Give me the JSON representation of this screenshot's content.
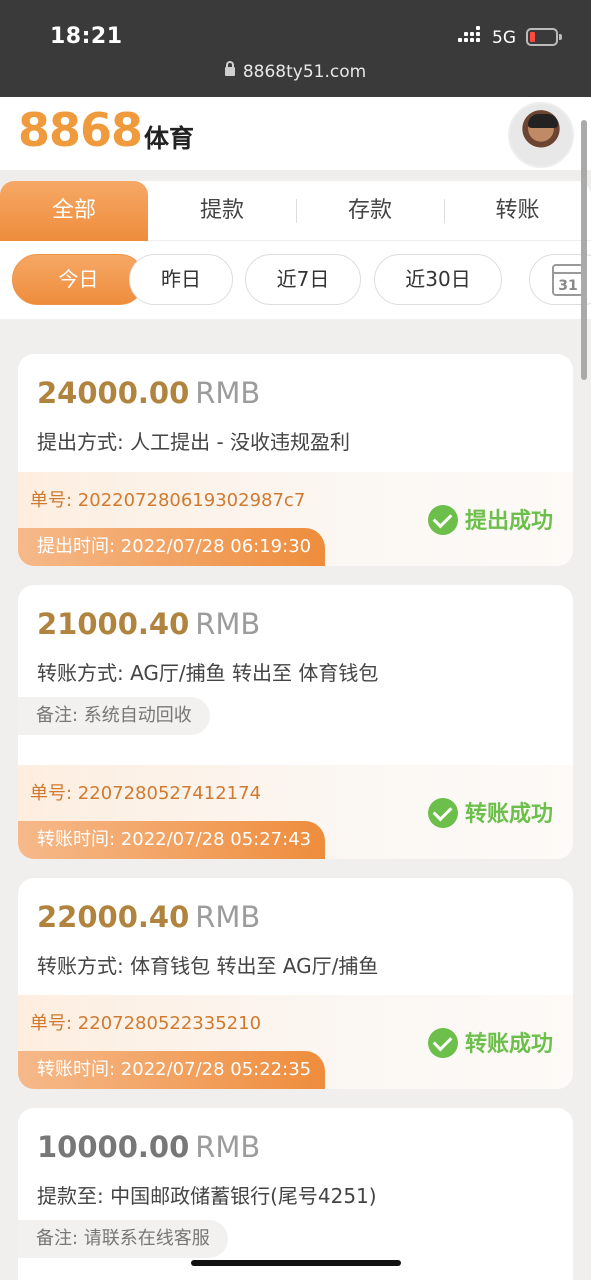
{
  "status_bar": {
    "time": "18:21",
    "network": "5G"
  },
  "browser": {
    "url": "8868ty51.com"
  },
  "header": {
    "logo_number": "8868",
    "logo_text": "体育"
  },
  "tabs": [
    {
      "label": "全部",
      "active": true
    },
    {
      "label": "提款",
      "active": false
    },
    {
      "label": "存款",
      "active": false
    },
    {
      "label": "转账",
      "active": false
    }
  ],
  "date_filters": [
    {
      "label": "今日",
      "active": true
    },
    {
      "label": "昨日",
      "active": false
    },
    {
      "label": "近7日",
      "active": false
    },
    {
      "label": "近30日",
      "active": false
    }
  ],
  "calendar_day": "31",
  "records": [
    {
      "amount": "24000.00",
      "unit": "RMB",
      "description": "提出方式: 人工提出 - 没收违规盈利",
      "note": "",
      "order_no": "单号: 20220728061930​2987c7",
      "time": "提出时间: 2022/07/28 06:19:30",
      "status": "提出成功"
    },
    {
      "amount": "21000.40",
      "unit": "RMB",
      "description": "转账方式: AG厅/捕鱼 转出至 体育钱包",
      "note": "备注: 系统自动回收",
      "order_no": "单号: 2207280527412174",
      "time": "转账时间: 2022/07/28 05:27:43",
      "status": "转账成功"
    },
    {
      "amount": "22000.40",
      "unit": "RMB",
      "description": "转账方式: 体育钱包 转出至 AG厅/捕鱼",
      "note": "",
      "order_no": "单号: 2207280522335210",
      "time": "转账时间: 2022/07/28 05:22:35",
      "status": "转账成功"
    },
    {
      "amount": "10000.00",
      "unit": "RMB",
      "description": "提款至: 中国邮政储蓄银行(尾号4251)",
      "note": "备注: 请联系在线客服",
      "order_no": "",
      "time": "",
      "status": ""
    }
  ],
  "colors": {
    "accent": "#ef9446",
    "amount_gold": "#b0843f",
    "amount_grey": "#777777",
    "success": "#6dbf4c"
  }
}
